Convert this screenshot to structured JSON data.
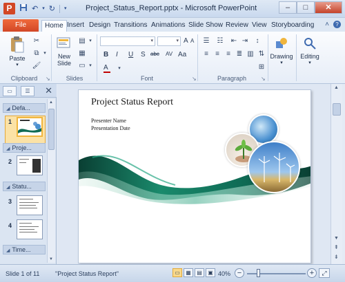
{
  "window": {
    "app_icon": "P",
    "title": "Project_Status_Report.pptx - Microsoft PowerPoint",
    "controls": {
      "minimize": "–",
      "maximize": "□",
      "close": "✕"
    }
  },
  "quick_access": {
    "save_icon": "save-icon",
    "undo_icon": "undo-icon",
    "repeat_icon": "repeat-icon",
    "customize_icon": "customize-icon"
  },
  "tabs": {
    "file": "File",
    "items": [
      "Home",
      "Insert",
      "Design",
      "Transitions",
      "Animations",
      "Slide Show",
      "Review",
      "View",
      "Storyboarding"
    ],
    "active": "Home"
  },
  "ribbon": {
    "clipboard": {
      "paste_label": "Paste",
      "group_label": "Clipboard"
    },
    "slides": {
      "new_slide_label": "New\nSlide",
      "group_label": "Slides"
    },
    "font": {
      "group_label": "Font",
      "format_buttons": [
        "B",
        "I",
        "U",
        "S",
        "abc",
        "AV",
        "Aa",
        "A",
        "A"
      ]
    },
    "paragraph": {
      "group_label": "Paragraph"
    },
    "drawing": {
      "label": "Drawing"
    },
    "editing": {
      "label": "Editing"
    }
  },
  "slide_panel": {
    "sections": [
      "Defa...",
      "Proje...",
      "Statu...",
      "Time..."
    ],
    "slide_numbers": [
      "1",
      "2",
      "3",
      "4"
    ]
  },
  "slide": {
    "title": "Project Status Report",
    "presenter": "Presenter Name",
    "date": "Presentation Date"
  },
  "statusbar": {
    "slide_info": "Slide 1 of 11",
    "theme": "\"Project Status Report\"",
    "zoom": "40%",
    "zoom_level": 0.4
  },
  "colors": {
    "accent_file": "#d24726",
    "wave_teal": "#0f6b55",
    "wave_deep": "#0a3f33",
    "sky": "#4a90d0",
    "selection": "#f0b53d"
  }
}
